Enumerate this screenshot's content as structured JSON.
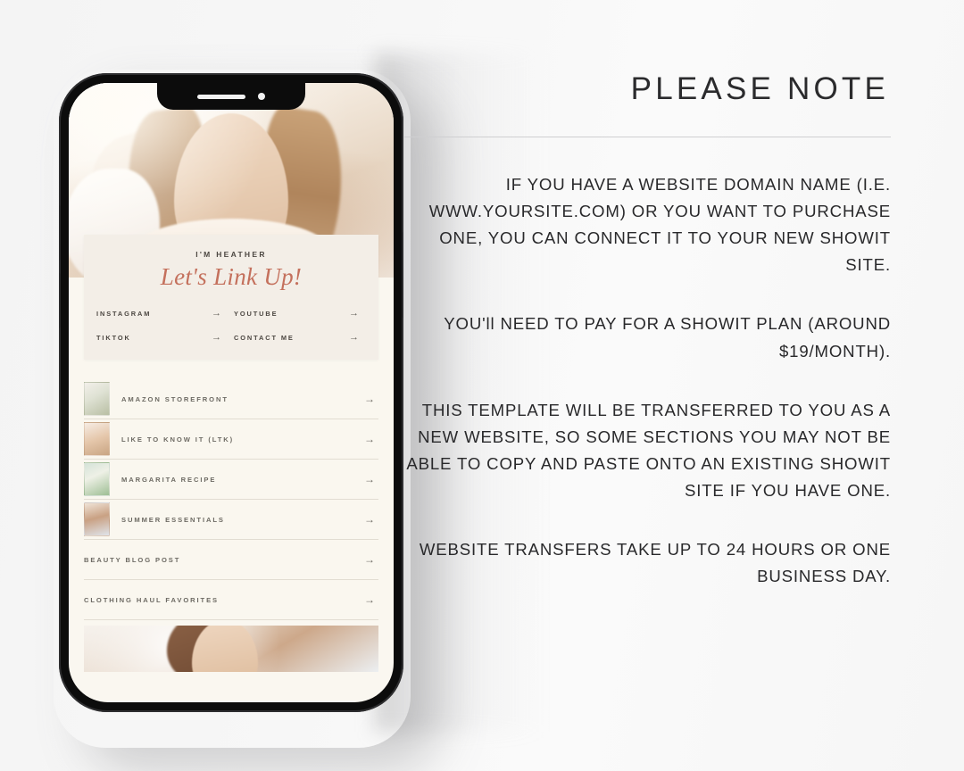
{
  "colors": {
    "page_background": "#f6f6f6",
    "phone_frame": "#0c0c0c",
    "card_background": "#f3eee7",
    "screen_background": "#faf7ef",
    "accent_script": "#c4705c",
    "body_text": "#29292b",
    "muted_text": "#6d6a63",
    "divider": "#cfcfd1"
  },
  "phone": {
    "notch": {
      "speaker_name": "earpiece-speaker",
      "camera_name": "front-camera"
    },
    "buttons": {
      "volume_up": "volume-up-button",
      "volume_down": "volume-down-button",
      "power": "power-button"
    },
    "hero_image_alt": "woman with hand in hair portrait",
    "card": {
      "eyebrow": "I'M HEATHER",
      "title": "Let's Link Up!",
      "social_links": [
        {
          "label": "INSTAGRAM",
          "arrow": "→"
        },
        {
          "label": "YOUTUBE",
          "arrow": "→"
        },
        {
          "label": "TIKTOK",
          "arrow": "→"
        },
        {
          "label": "CONTACT ME",
          "arrow": "→"
        }
      ]
    },
    "link_list": [
      {
        "label": "AMAZON STOREFRONT",
        "arrow": "→",
        "has_thumbnail": true,
        "thumb_class": "t1"
      },
      {
        "label": "LIKE TO KNOW IT (LTK)",
        "arrow": "→",
        "has_thumbnail": true,
        "thumb_class": "t2"
      },
      {
        "label": "MARGARITA RECIPE",
        "arrow": "→",
        "has_thumbnail": true,
        "thumb_class": "t3"
      },
      {
        "label": "SUMMER ESSENTIALS",
        "arrow": "→",
        "has_thumbnail": true,
        "thumb_class": "t4"
      },
      {
        "label": "BEAUTY BLOG POST",
        "arrow": "→",
        "has_thumbnail": false,
        "thumb_class": "none"
      },
      {
        "label": "CLOTHING HAUL FAVORITES",
        "arrow": "→",
        "has_thumbnail": false,
        "thumb_class": "none"
      }
    ],
    "bottom_image_alt": "woman applying face cream"
  },
  "note": {
    "title": "PLEASE NOTE",
    "paragraphs": [
      "IF YOU HAVE A WEBSITE DOMAIN NAME (I.E. WWW.YOURSITE.COM) OR YOU WANT TO PURCHASE ONE, YOU CAN CONNECT IT TO YOUR NEW SHOWIT SITE.",
      "YOU'll NEED TO PAY FOR A SHOWIT PLAN (AROUND $19/MONTH).",
      "THIS TEMPLATE WILL BE TRANSFERRED TO YOU AS A NEW WEBSITE, SO SOME SECTIONS YOU MAY NOT BE ABLE TO COPY AND PASTE ONTO AN EXISTING SHOWIT SITE IF YOU HAVE ONE.",
      "WEBSITE TRANSFERS TAKE UP TO 24 HOURS OR ONE BUSINESS DAY."
    ]
  }
}
